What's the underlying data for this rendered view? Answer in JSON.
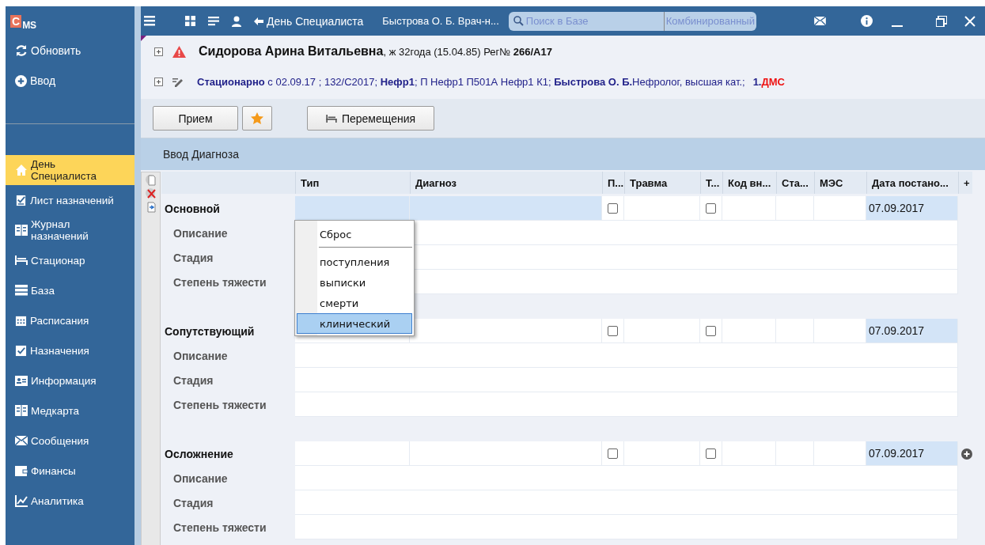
{
  "app": {
    "logo_mark": "C",
    "logo_text": "MS"
  },
  "sidebar": {
    "actions": [
      {
        "label": "Обновить"
      },
      {
        "label": "Ввод"
      }
    ],
    "items": [
      {
        "label": "День Специалиста",
        "selected": true
      },
      {
        "label": "Лист назначений",
        "selected": false
      },
      {
        "label": "Журнал назначений",
        "selected": false
      },
      {
        "label": "Стационар",
        "selected": false
      },
      {
        "label": "База",
        "selected": false
      },
      {
        "label": "Расписания",
        "selected": false
      },
      {
        "label": "Назначения",
        "selected": false
      },
      {
        "label": "Информация",
        "selected": false
      },
      {
        "label": "Медкарта",
        "selected": false
      },
      {
        "label": "Сообщения",
        "selected": false
      },
      {
        "label": "Финансы",
        "selected": false
      },
      {
        "label": "Аналитика",
        "selected": false
      }
    ]
  },
  "topbar": {
    "back_link": "День Специалиста",
    "doctor": "Быстрова О. Б. Врач-н...",
    "search": {
      "placeholder": "Поиск в Базе"
    },
    "search_mode": "Комбинированный"
  },
  "patient": {
    "name": "Сидорова Арина Витальевна",
    "details": ", ж 32года (15.04.85) Рег№ **266/А17**",
    "stay": "**Стационарно** с 02.09.17  ; 132/С2017; **Нефр1**; П Нефр1 П501А Нефр1 К1; **Быстрова О. Б.**Нефролог, высшая кат.;",
    "insurance_number": "1.",
    "insurance_name": "ДМС"
  },
  "toolbar": {
    "buttons": [
      {
        "kind": "text",
        "label": "Прием"
      },
      {
        "kind": "star"
      },
      {
        "kind": "moves",
        "label": "Перемещения"
      }
    ]
  },
  "section": {
    "title": "Ввод Диагноза"
  },
  "table": {
    "columns": [
      "Тип",
      "Диагноз",
      "П...",
      "Травма",
      "Т...",
      "Код вн...",
      "Ста...",
      "МЭС",
      "Дата постано...",
      "+"
    ],
    "groups": [
      {
        "title": "Основной",
        "selected": true,
        "p_checked": false,
        "t_checked": false,
        "date": "07.09.2017",
        "add_button": false,
        "rows": [
          "Описание",
          "Стадия",
          "Степень тяжести"
        ]
      },
      {
        "title": "Сопутствующий",
        "selected": false,
        "p_checked": false,
        "t_checked": false,
        "date": "07.09.2017",
        "add_button": false,
        "rows": [
          "Описание",
          "Стадия",
          "Степень тяжести"
        ]
      },
      {
        "title": "Осложнение",
        "selected": false,
        "p_checked": false,
        "t_checked": false,
        "date": "07.09.2017",
        "add_button": true,
        "rows": [
          "Описание",
          "Стадия",
          "Степень тяжести"
        ]
      }
    ]
  },
  "type_menu": {
    "items": [
      {
        "kind": "reset",
        "label": "Сброс",
        "selected": false
      },
      {
        "kind": "option",
        "label": "поступления",
        "selected": false
      },
      {
        "kind": "option",
        "label": "выписки",
        "selected": false
      },
      {
        "kind": "option",
        "label": "смерти",
        "selected": false
      },
      {
        "kind": "option",
        "label": "клинический",
        "selected": true
      }
    ]
  }
}
